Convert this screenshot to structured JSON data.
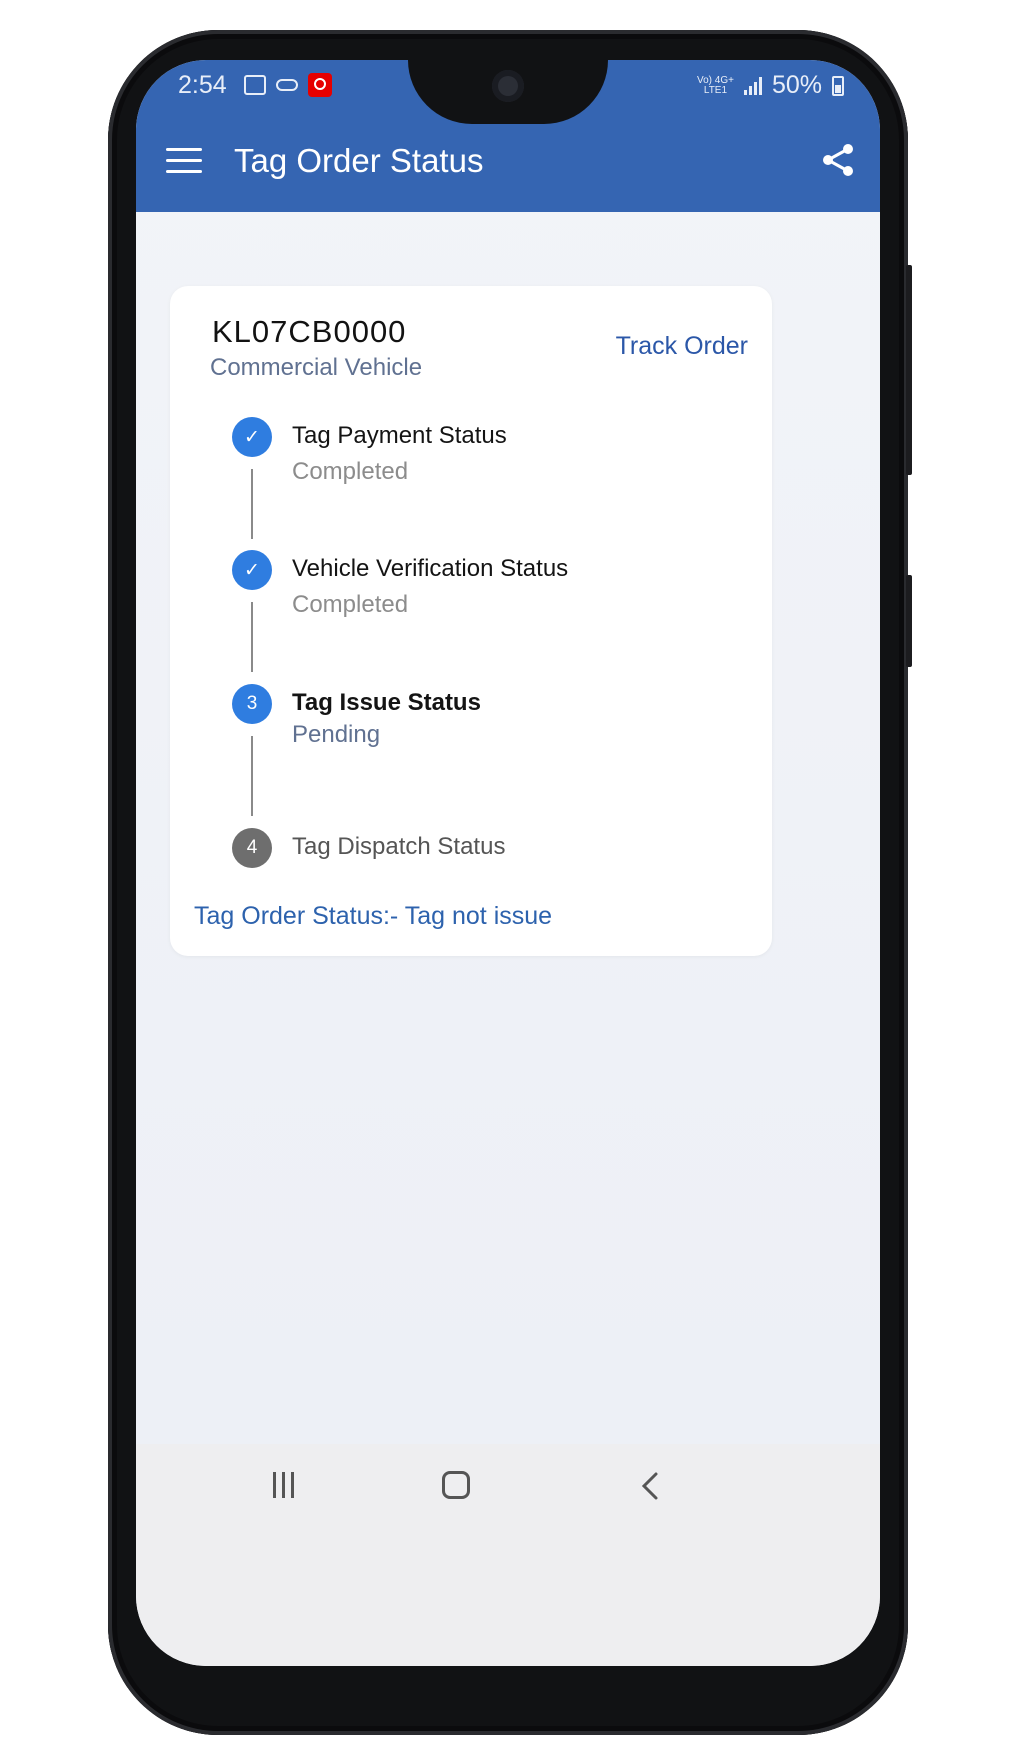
{
  "status_bar": {
    "time": "2:54",
    "network_top": "Vo) 4G+",
    "network_bottom": "LTE1",
    "battery": "50%"
  },
  "app_bar": {
    "title": "Tag Order Status",
    "menu_icon": "hamburger-menu-icon",
    "share_icon": "share-icon"
  },
  "card": {
    "plate_number": "KL07CB0000",
    "vehicle_type": "Commercial Vehicle",
    "track_order_label": "Track Order",
    "steps": [
      {
        "marker": "✓",
        "title": "Tag Payment Status",
        "status": "Completed"
      },
      {
        "marker": "✓",
        "title": "Vehicle Verification Status",
        "status": "Completed"
      },
      {
        "marker": "3",
        "title": "Tag Issue Status",
        "status": "Pending"
      },
      {
        "marker": "4",
        "title": "Tag Dispatch Status",
        "status": ""
      }
    ],
    "summary": "Tag Order Status:- Tag not issue"
  },
  "colors": {
    "primary": "#3565b2",
    "step_active": "#2f7de0",
    "step_inactive": "#6e6e6e",
    "link": "#2b57a8"
  },
  "nav_bar": {
    "icons": [
      "recents-icon",
      "home-icon",
      "back-icon"
    ]
  }
}
